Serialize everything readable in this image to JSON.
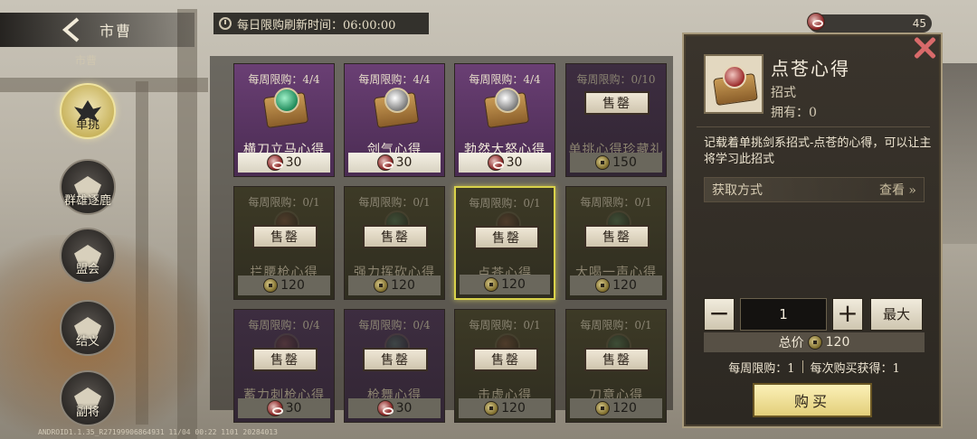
{
  "header": {
    "title": "市曹",
    "refresh_text": "每日限购刷新时间：06:00:00",
    "currency_value": "45"
  },
  "sidebar": {
    "top_partial_label": "市曹",
    "items": [
      {
        "label": "单挑",
        "active": true
      },
      {
        "label": "群雄逐鹿",
        "active": false
      },
      {
        "label": "盟会",
        "active": false
      },
      {
        "label": "结义",
        "active": false
      },
      {
        "label": "副将",
        "active": false
      }
    ]
  },
  "shop": {
    "sold_label": "售罄",
    "items": [
      {
        "limit": "每周限购：4/4",
        "name": "横刀立马心得",
        "price": "30",
        "currency": "red",
        "state": "available",
        "orb": "green"
      },
      {
        "limit": "每周限购：4/4",
        "name": "剑气心得",
        "price": "30",
        "currency": "red",
        "state": "available",
        "orb": "grey"
      },
      {
        "limit": "每周限购：4/4",
        "name": "勃然大怒心得",
        "price": "30",
        "currency": "red",
        "state": "available",
        "orb": "grey"
      },
      {
        "limit": "每周限购：0/10",
        "name": "单挑心得珍藏礼包",
        "price": "150",
        "currency": "gold",
        "state": "sold"
      },
      {
        "limit": "每周限购：0/1",
        "name": "拦腰枪心得",
        "price": "120",
        "currency": "gold",
        "state": "sold"
      },
      {
        "limit": "每周限购：0/1",
        "name": "强力挥砍心得",
        "price": "120",
        "currency": "gold",
        "state": "sold"
      },
      {
        "limit": "每周限购：0/1",
        "name": "点苍心得",
        "price": "120",
        "currency": "gold",
        "state": "sold",
        "selected": true
      },
      {
        "limit": "每周限购：0/1",
        "name": "大喝一声心得",
        "price": "120",
        "currency": "gold",
        "state": "sold"
      },
      {
        "limit": "每周限购：0/4",
        "name": "蓄力刺枪心得",
        "price": "30",
        "currency": "red",
        "state": "sold"
      },
      {
        "limit": "每周限购：0/4",
        "name": "枪舞心得",
        "price": "30",
        "currency": "red",
        "state": "sold"
      },
      {
        "limit": "每周限购：0/1",
        "name": "击虚心得",
        "price": "120",
        "currency": "gold",
        "state": "sold"
      },
      {
        "limit": "每周限购：0/1",
        "name": "刀意心得",
        "price": "120",
        "currency": "gold",
        "state": "sold"
      }
    ]
  },
  "detail": {
    "name": "点苍心得",
    "type": "招式",
    "owned": "拥有：0",
    "description": "记载着单挑剑系招式-点苍的心得，可以让主将学习此招式",
    "obtain_label": "获取方式",
    "view_label": "查看",
    "quantity": "1",
    "minus_label": "−",
    "plus_label": "+",
    "max_label": "最大",
    "total_label": "总价",
    "total_value": "120",
    "weekly_limit": "每周限购：1",
    "per_purchase": "每次购买获得：1",
    "buy_label": "购买"
  },
  "footer": {
    "build_text": "ANDROID1.1.35_R27199906864931 11/04 00:22 1101 20284013"
  }
}
